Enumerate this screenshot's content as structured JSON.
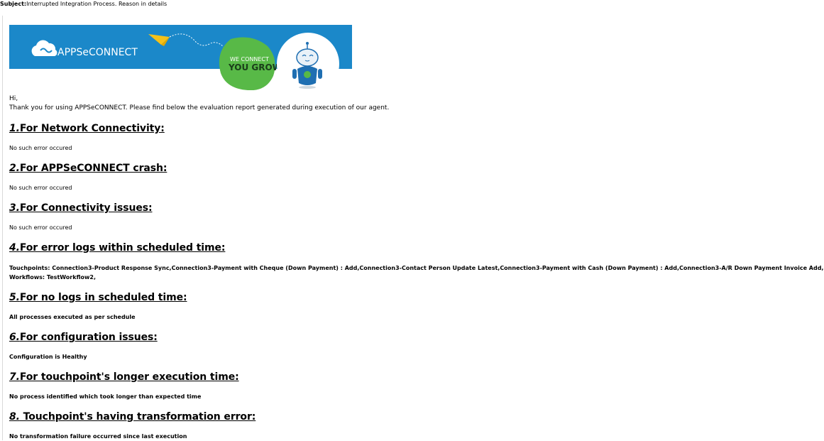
{
  "subject": {
    "label": "Subject:",
    "text": "Interrupted Integration Process. Reason in details"
  },
  "banner": {
    "logo_text": "APPSeCONNECT",
    "tagline_top": "WE CONNECT",
    "tagline_bottom": "YOU GROW",
    "colors": {
      "blue": "#1b88c9",
      "green": "#58b947",
      "yellow": "#f5c118",
      "robot_blue": "#1f6fb2"
    }
  },
  "greeting": "Hi,",
  "intro": "Thank you for using APPSeCONNECT. Please find below the evaluation report generated during execution of our agent.",
  "sections": [
    {
      "num": "1.",
      "title": "For Network Connectivity:",
      "body": "No such error occured"
    },
    {
      "num": "2.",
      "title": "For APPSeCONNECT crash:",
      "body": "No such error occured"
    },
    {
      "num": "3.",
      "title": "For Connectivity issues:",
      "body": "No such error occured"
    },
    {
      "num": "4.",
      "title": "For error logs within scheduled time:",
      "body": "Touchpoints: Connection3-Product Response Sync,Connection3-Payment with Cheque (Down Payment) : Add,Connection3-Contact Person Update Latest,Connection3-Payment with Cash (Down Payment) : Add,Connection3-A/R Down Payment Invoice Add,",
      "body_line2": "Workflows: TestWorkflow2,"
    },
    {
      "num": "5.",
      "title": "For no logs in scheduled time:",
      "body": "All processes executed as per schedule"
    },
    {
      "num": "6.",
      "title": "For configuration issues:",
      "body": "Configuration is Healthy"
    },
    {
      "num": "7.",
      "title": "For touchpoint's longer execution time:",
      "body": "No process identified which took longer than expected time"
    },
    {
      "num": "8.",
      "title": " Touchpoint's having transformation error:",
      "body": "No transformation failure occurred since last execution"
    }
  ]
}
